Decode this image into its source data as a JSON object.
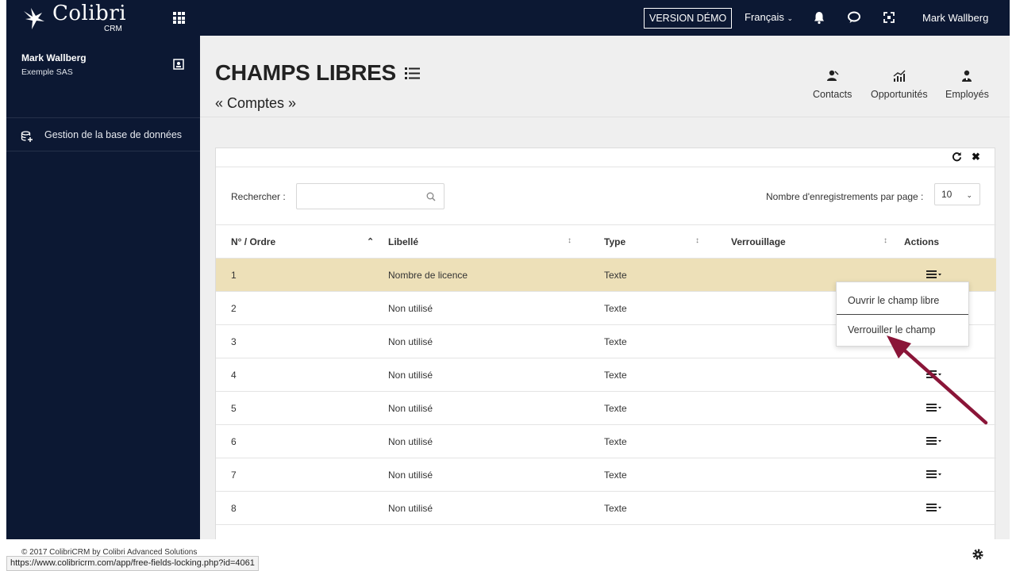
{
  "app": {
    "logo_text": "Colibri",
    "logo_sub": "CRM",
    "version_demo": "VERSION DÉMO",
    "language": "Français",
    "user_name": "Mark Wallberg"
  },
  "sidebar": {
    "user_name": "Mark Wallberg",
    "company": "Exemple SAS",
    "items": [
      {
        "label": "Gestion de la base de données",
        "icon": "database-add-icon"
      }
    ]
  },
  "header": {
    "title": "CHAMPS LIBRES",
    "subtitle": "« Comptes »",
    "quick_links": [
      {
        "label": "Contacts",
        "icon": "contacts-icon"
      },
      {
        "label": "Opportunités",
        "icon": "chart-icon"
      },
      {
        "label": "Employés",
        "icon": "employee-icon"
      }
    ]
  },
  "table_controls": {
    "search_label": "Rechercher :",
    "search_value": "",
    "perpage_label": "Nombre d'enregistrements par page :",
    "perpage_value": "10"
  },
  "table": {
    "columns": [
      "N° / Ordre",
      "Libellé",
      "Type",
      "Verrouillage",
      "Actions"
    ],
    "rows": [
      {
        "num": "1",
        "label": "Nombre de licence",
        "type": "Texte",
        "lock": ""
      },
      {
        "num": "2",
        "label": "Non utilisé",
        "type": "Texte",
        "lock": ""
      },
      {
        "num": "3",
        "label": "Non utilisé",
        "type": "Texte",
        "lock": ""
      },
      {
        "num": "4",
        "label": "Non utilisé",
        "type": "Texte",
        "lock": ""
      },
      {
        "num": "5",
        "label": "Non utilisé",
        "type": "Texte",
        "lock": ""
      },
      {
        "num": "6",
        "label": "Non utilisé",
        "type": "Texte",
        "lock": ""
      },
      {
        "num": "7",
        "label": "Non utilisé",
        "type": "Texte",
        "lock": ""
      },
      {
        "num": "8",
        "label": "Non utilisé",
        "type": "Texte",
        "lock": ""
      }
    ]
  },
  "dropdown": {
    "items": [
      "Ouvrir le champ libre",
      "Verrouiller le champ"
    ]
  },
  "footer": {
    "copyright": "© 2017 ColibriCRM by Colibri Advanced Solutions",
    "status_url": "https://www.colibricrm.com/app/free-fields-locking.php?id=4061"
  },
  "colors": {
    "navy": "#0c1833",
    "highlight_row": "#ede0b8",
    "arrow": "#8a1538"
  }
}
